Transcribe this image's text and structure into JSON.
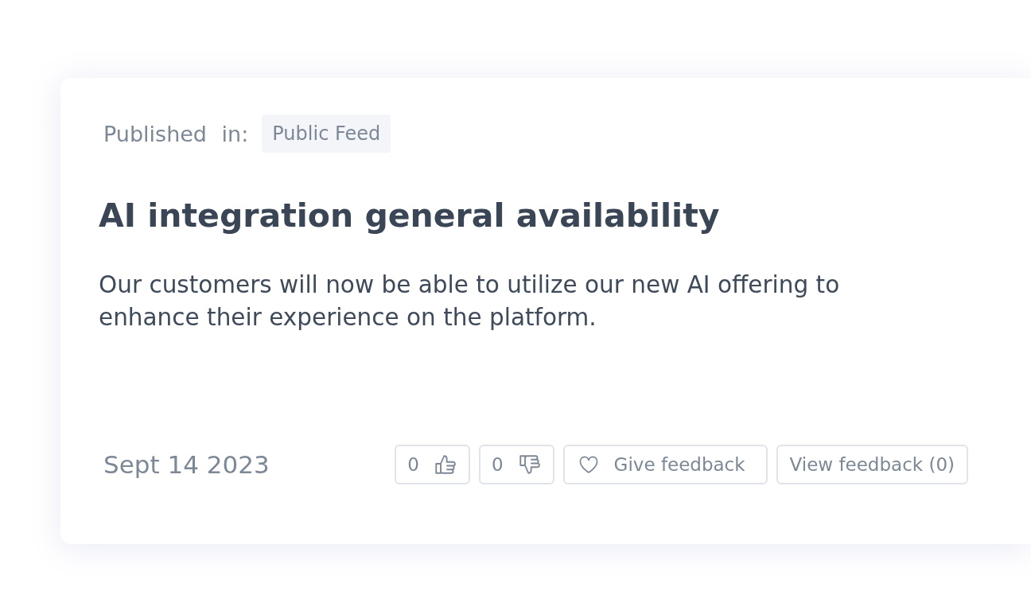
{
  "card": {
    "published_label": "Published in:",
    "channel_tag": "Public Feed",
    "title": "AI integration general availability",
    "body": "Our customers will now be able to utilize our new AI offering to enhance their experience on the platform.",
    "date": "Sept 14 2023",
    "actions": [
      {
        "kind": "upvote",
        "count": "0"
      },
      {
        "kind": "downvote",
        "count": "0"
      },
      {
        "kind": "give_feedback",
        "label": "Give feedback"
      },
      {
        "kind": "view_feedback",
        "label": "View feedback (0)"
      }
    ]
  }
}
